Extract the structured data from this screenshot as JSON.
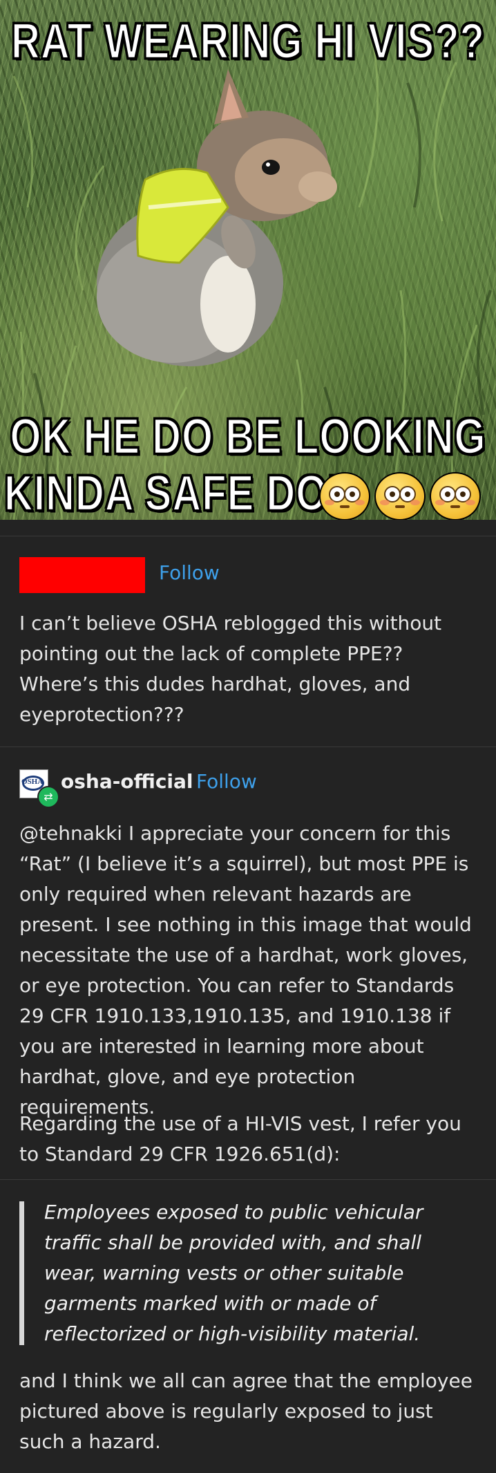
{
  "meme": {
    "caption_top": "RAT WEARING HI VIS??",
    "caption_bottom_line1": "OK HE DO BE LOOKING",
    "caption_bottom_line2": "KINDA SAFE DOE",
    "emoji": [
      "flushed-face-emoji",
      "flushed-face-emoji",
      "flushed-face-emoji"
    ]
  },
  "post1": {
    "follow_label": "Follow",
    "body": "I can’t believe OSHA reblogged this without pointing out the lack of complete PPE?? Where’s this dudes hardhat, gloves, and eyeprotection???"
  },
  "post2": {
    "username": "osha-official",
    "avatar_text": "OSHA",
    "follow_label": "Follow",
    "paragraph1": "@tehnakki I appreciate your concern for this “Rat” (I believe it’s  a squirrel), but most PPE is only required when relevant hazards are present.  I see nothing in this image that would necessitate the use of a hardhat, work gloves, or eye protection. You can refer to Standards 29 CFR 1910.133,1910.135, and 1910.138 if you are interested in learning more about hardhat, glove, and eye protection requirements.",
    "paragraph2": "Regarding the use of a HI-VIS vest, I refer you to Standard 29 CFR 1926.651(d):",
    "quote": "Employees exposed to public vehicular traffic shall be provided with,  and shall wear, warning vests or other suitable garments marked with or  made of reflectorized or high-visibility material.",
    "paragraph3": "and I think we all can agree that the employee pictured above is regularly exposed to just such a hazard."
  },
  "colors": {
    "panel_bg": "#232323",
    "follow_blue": "#3ea0ea",
    "redaction_red": "#ff0000",
    "reblog_green": "#1fb85c"
  }
}
